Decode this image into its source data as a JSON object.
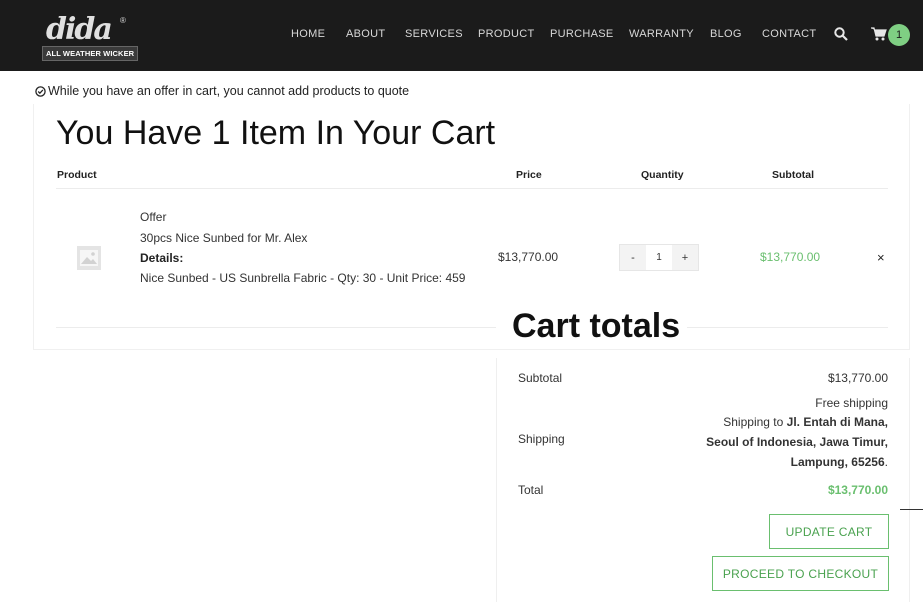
{
  "header": {
    "logo_text": "dida",
    "logo_tagline": "ALL WEATHER WICKER",
    "nav": [
      "HOME",
      "ABOUT",
      "SERVICES",
      "PRODUCT",
      "PURCHASE",
      "WARRANTY",
      "BLOG",
      "CONTACT"
    ],
    "cart_count": "1"
  },
  "notice": "While you have an offer in cart, you cannot add products to quote",
  "cart": {
    "title": "You Have 1 Item In Your Cart",
    "columns": {
      "product": "Product",
      "price": "Price",
      "quantity": "Quantity",
      "subtotal": "Subtotal"
    },
    "item": {
      "line1": "Offer",
      "line2": "30pcs Nice Sunbed for Mr. Alex",
      "details_label": "Details:",
      "details": "Nice Sunbed - US Sunbrella Fabric - Qty: 30 - Unit Price: 459",
      "price": "$13,770.00",
      "qty_minus": "-",
      "qty": "1",
      "qty_plus": "+",
      "subtotal": "$13,770.00",
      "remove": "×"
    }
  },
  "totals": {
    "title": "Cart totals",
    "subtotal_label": "Subtotal",
    "subtotal_value": "$13,770.00",
    "shipping_label": "Shipping",
    "shipping_method": "Free shipping",
    "shipping_to_prefix": "Shipping to ",
    "address_line1": "Jl. Entah di Mana,",
    "address_line2": "Seoul of Indonesia, Jawa Timur,",
    "address_line3": "Lampung, 65256",
    "address_end": ".",
    "total_label": "Total",
    "total_value": "$13,770.00",
    "update_cart": "UPDATE CART",
    "checkout": "PROCEED TO CHECKOUT"
  },
  "colors": {
    "accent": "#6abf6f",
    "header_bg": "#1b1b1b"
  }
}
